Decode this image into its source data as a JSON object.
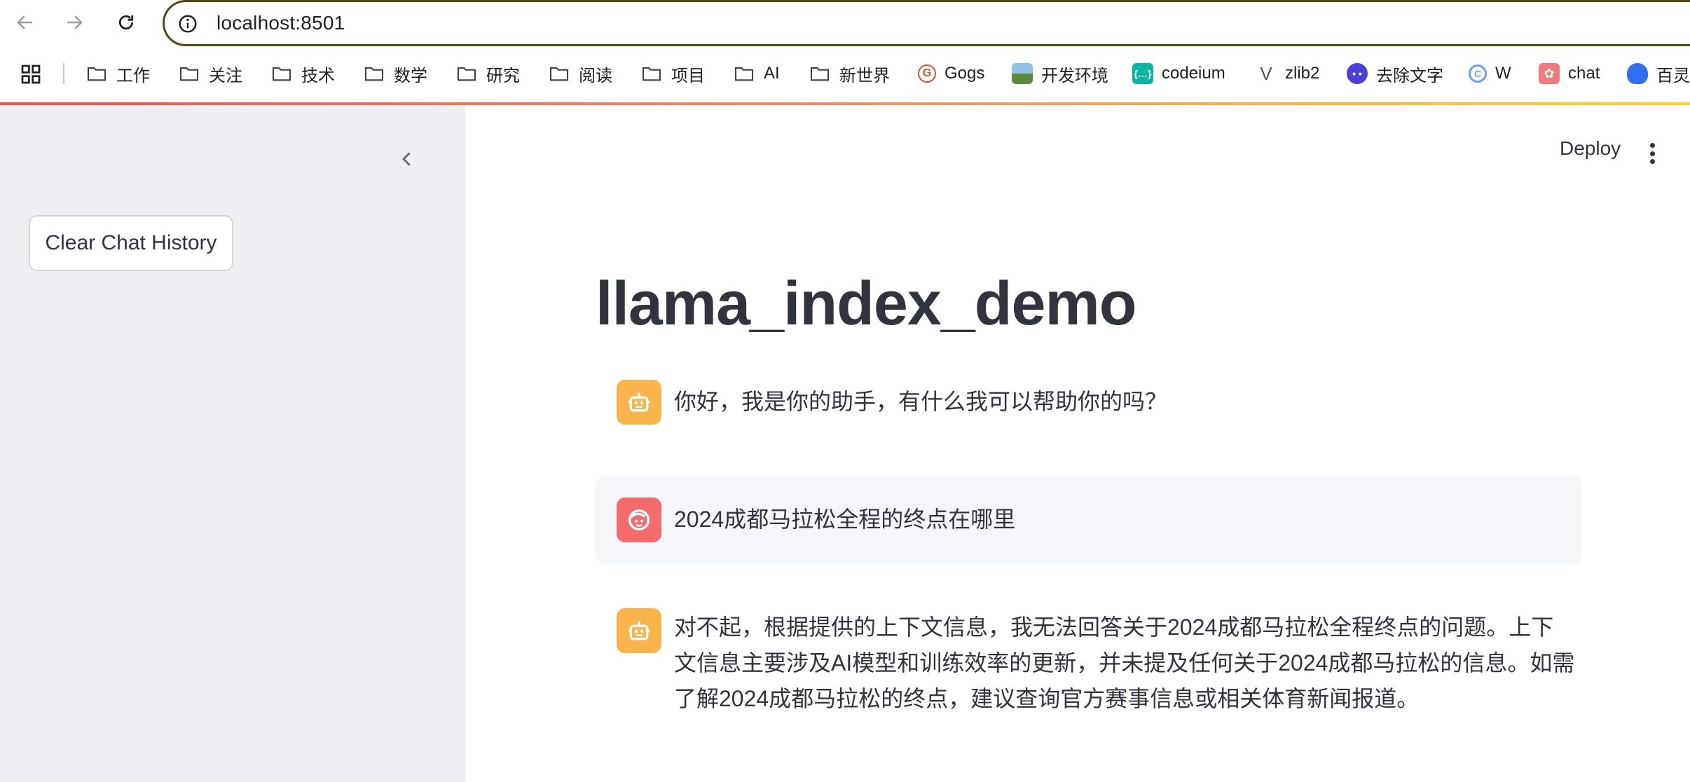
{
  "browser": {
    "back_icon": "arrow-left-icon",
    "forward_icon": "arrow-right-icon",
    "reload_icon": "reload-icon",
    "url": "localhost:8501",
    "bookmarks": [
      {
        "label": "工作",
        "icon": "folder-icon"
      },
      {
        "label": "关注",
        "icon": "folder-icon"
      },
      {
        "label": "技术",
        "icon": "folder-icon"
      },
      {
        "label": "数学",
        "icon": "folder-icon"
      },
      {
        "label": "研究",
        "icon": "folder-icon"
      },
      {
        "label": "阅读",
        "icon": "folder-icon"
      },
      {
        "label": "项目",
        "icon": "folder-icon"
      },
      {
        "label": "AI",
        "icon": "folder-icon"
      },
      {
        "label": "新世界",
        "icon": "folder-icon"
      },
      {
        "label": "Gogs",
        "icon": "gogs-icon"
      },
      {
        "label": "开发环境",
        "icon": "landscape-icon"
      },
      {
        "label": "codeium",
        "icon": "codeium-icon"
      },
      {
        "label": "zlib2",
        "icon": "zlib-icon"
      },
      {
        "label": "去除文字",
        "icon": "face-icon"
      },
      {
        "label": "W",
        "icon": "w-icon"
      },
      {
        "label": "chat",
        "icon": "openai-icon"
      },
      {
        "label": "百灵",
        "icon": "baidu-icon"
      }
    ]
  },
  "sidebar": {
    "clear_button": "Clear Chat History"
  },
  "header": {
    "deploy": "Deploy"
  },
  "main": {
    "title": "llama_index_demo",
    "messages": [
      {
        "role": "assistant",
        "text": "你好，我是你的助手，有什么我可以帮助你的吗？"
      },
      {
        "role": "user",
        "text": "2024成都马拉松全程的终点在哪里"
      },
      {
        "role": "assistant",
        "text": "对不起，根据提供的上下文信息，我无法回答关于2024成都马拉松全程终点的问题。上下文信息主要涉及AI模型和训练效率的更新，并未提及任何关于2024成都马拉松的信息。如需了解2024成都马拉松的终点，建议查询官方赛事信息或相关体育新闻报道。"
      }
    ]
  },
  "colors": {
    "accent": "#ff4b4b",
    "bot_avatar": "#fbb44c",
    "user_avatar": "#f46b6b",
    "sidebar_bg": "#eeeff3"
  }
}
